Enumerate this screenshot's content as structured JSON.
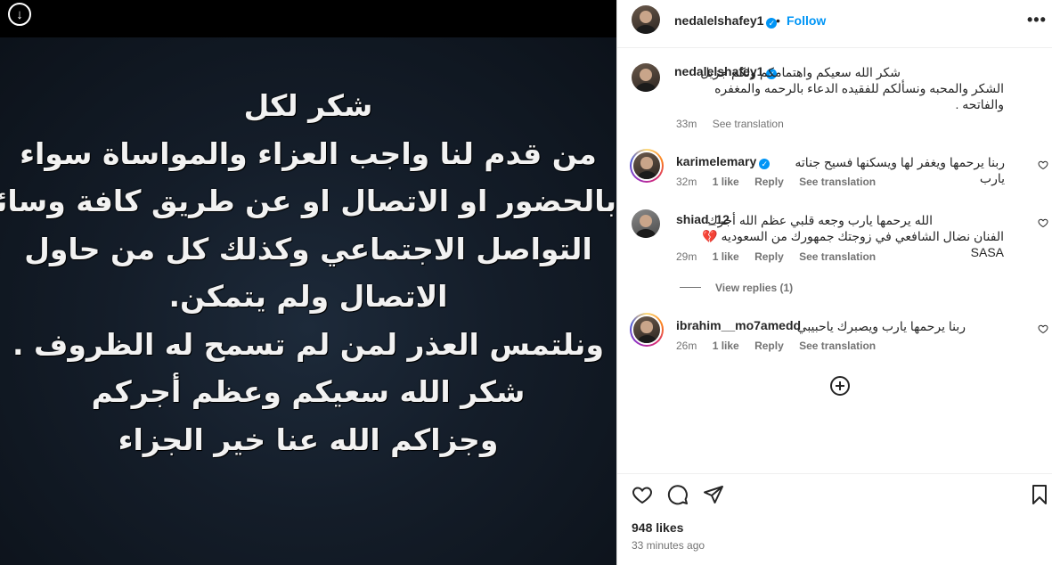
{
  "post": {
    "image_lines": [
      "شكر لكل",
      "من قدم لنا واجب العزاء والمواساة سواء",
      "بالحضور او الاتصال او عن طريق كافة وسائل",
      "التواصل الاجتماعي وكذلك كل من حاول",
      "الاتصال ولم يتمكن.",
      "ونلتمس العذر لمن لم تسمح له الظروف .",
      "شكر الله سعيكم وعظم أجركم",
      "وجزاكم الله عنا خير الجزاء"
    ],
    "download_icon": "arrow-down-circle-icon"
  },
  "header": {
    "username": "nedalelshafey1",
    "separator": "•",
    "follow_label": "Follow",
    "more_label": "•••"
  },
  "caption": {
    "username": "nedalelshafey1",
    "text": "شكر الله سعيكم واهتمامكم ولكم جزيل الشكر والمحبه ونسألكم للفقيده الدعاء بالرحمه والمغفره والفاتحه .",
    "time": "33m",
    "see_translation": "See translation"
  },
  "comments": [
    {
      "username": "karimelemary",
      "verified": true,
      "text": "ربنا يرحمها ويغفر لها ويسكنها فسيح جناته يارب",
      "time": "32m",
      "likes": "1 like",
      "reply": "Reply",
      "see_translation": "See translation"
    },
    {
      "username": "shiad_12",
      "verified": false,
      "text": "الله يرحمها يارب وجعه قلبي عظم الله أجرك الفنان نضال الشافعي في زوجتك جمهورك من السعوديه 💔SASA",
      "time": "29m",
      "likes": "1 like",
      "reply": "Reply",
      "see_translation": "See translation",
      "view_replies": "View replies (1)"
    },
    {
      "username": "ibrahim__mo7amedd",
      "verified": false,
      "text": "ربنا يرحمها يارب ويصبرك ياحبيبي",
      "time": "26m",
      "likes": "1 like",
      "reply": "Reply",
      "see_translation": "See translation"
    }
  ],
  "footer": {
    "likes": "948 likes",
    "time_ago": "33 minutes ago"
  },
  "colors": {
    "accent": "#0095f6",
    "text": "#262626",
    "muted": "#737373"
  }
}
